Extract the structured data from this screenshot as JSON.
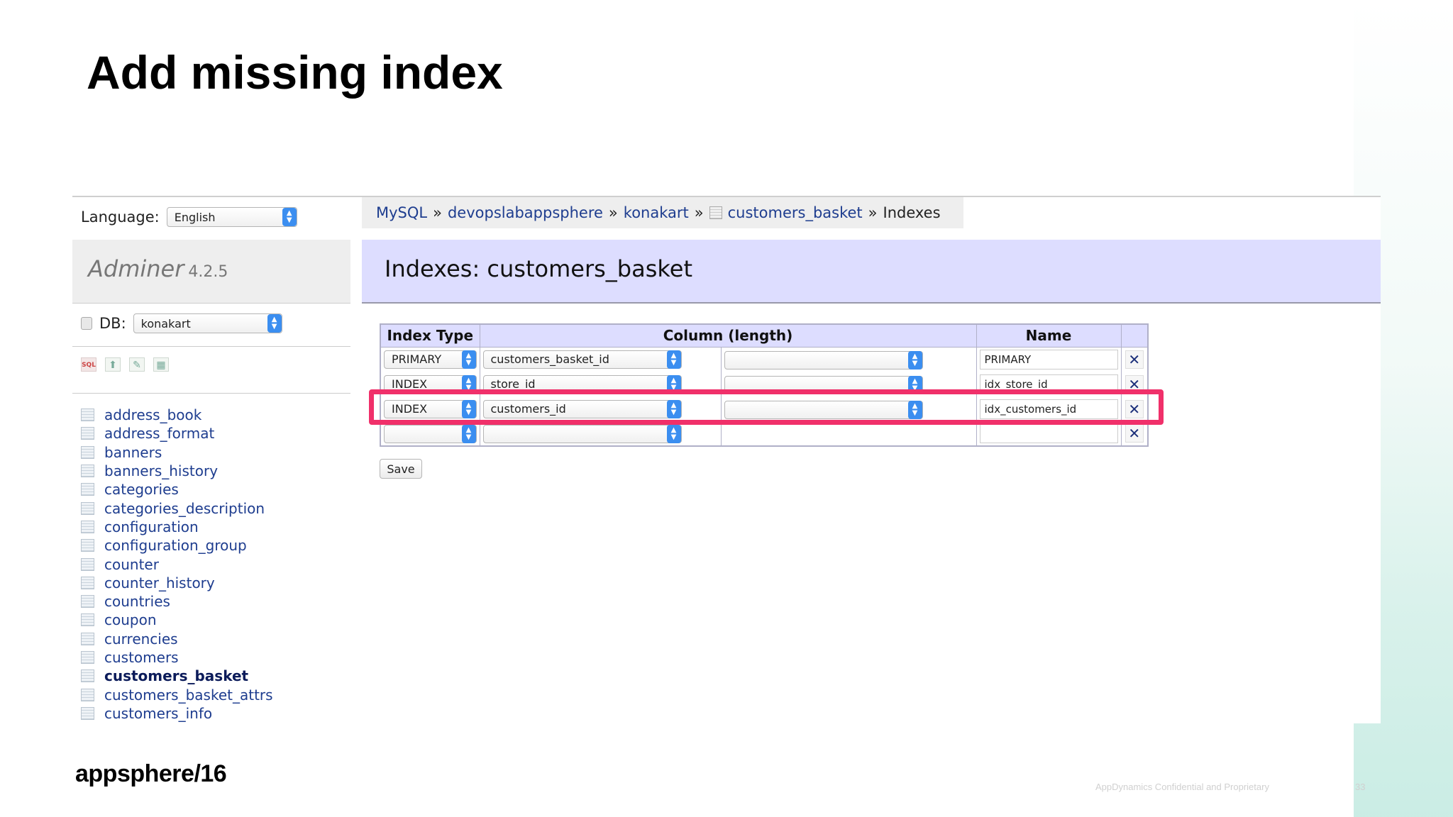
{
  "slide": {
    "title": "Add missing index",
    "brand": "appsphere/16",
    "footer_note": "AppDynamics Confidential and Proprietary",
    "page_number": "33"
  },
  "sidebar": {
    "language_label": "Language:",
    "language_value": "English",
    "app_name": "Adminer",
    "app_version": "4.2.5",
    "db_label": "DB:",
    "db_value": "konakart",
    "tables": [
      "address_book",
      "address_format",
      "banners",
      "banners_history",
      "categories",
      "categories_description",
      "configuration",
      "configuration_group",
      "counter",
      "counter_history",
      "countries",
      "coupon",
      "currencies",
      "customers",
      "customers_basket",
      "customers_basket_attrs",
      "customers_info"
    ],
    "active_table": "customers_basket"
  },
  "breadcrumb": {
    "items": [
      "MySQL",
      "devopslabappsphere",
      "konakart",
      "customers_basket"
    ],
    "separator": "»",
    "current": "Indexes"
  },
  "page": {
    "header": "Indexes: customers_basket"
  },
  "index_table": {
    "headers": [
      "Index Type",
      "Column (length)",
      "Name"
    ],
    "rows": [
      {
        "type": "PRIMARY",
        "column": "customers_basket_id",
        "column2": "",
        "name": "PRIMARY"
      },
      {
        "type": "INDEX",
        "column": "store_id",
        "column2": "",
        "name": "idx_store_id"
      },
      {
        "type": "INDEX",
        "column": "customers_id",
        "column2": "",
        "name": "idx_customers_id"
      },
      {
        "type": "",
        "column": "",
        "column2": "",
        "name": ""
      }
    ],
    "remove_glyph": "✕",
    "save_label": "Save"
  },
  "colors": {
    "highlight": "#f0306a",
    "link": "#1e3d8f",
    "header_bg": "#ddddff",
    "select_arrow": "#3b8ef0"
  }
}
